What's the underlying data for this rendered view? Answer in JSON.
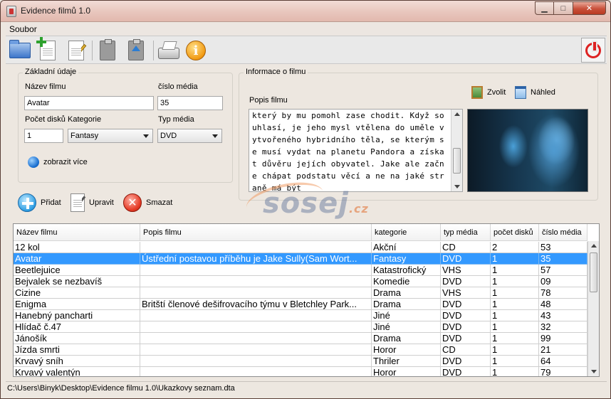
{
  "window": {
    "title": "Evidence filmů 1.0"
  },
  "menu": {
    "items": [
      "Soubor"
    ]
  },
  "basic_info": {
    "group_title": "Základní údaje",
    "name_label": "Název filmu",
    "name_value": "Avatar",
    "media_number_label": "číslo média",
    "media_number_value": "35",
    "disc_count_label": "Počet disků",
    "disc_count_value": "1",
    "category_label": "Kategorie",
    "category_value": "Fantasy",
    "media_type_label": "Typ média",
    "media_type_value": "DVD",
    "show_more_label": "zobrazit více"
  },
  "actions": {
    "add": "Přidat",
    "edit": "Upravit",
    "delete": "Smazat"
  },
  "film_info": {
    "group_title": "Informace o filmu",
    "description_label": "Popis filmu",
    "choose_label": "Zvolit",
    "preview_label": "Náhled",
    "description_lines": [
      "který by mu pomohl zase chodit. Když so",
      "uhlasí, je jeho mysl vtělena do uměle v",
      "ytvořeného hybridního těla, se kterým s",
      "e musí vydat na planetu Pandora a získa",
      "t důvěru jejích obyvatel. Jake ale začn",
      "e chápat podstatu věcí a ne na jaké str",
      "aně má být"
    ]
  },
  "watermark": {
    "text": "sosej",
    "suffix": ".cz"
  },
  "table": {
    "columns": [
      "Název filmu",
      "Popis filmu",
      "kategorie",
      "typ média",
      "počet disků",
      "číslo média"
    ],
    "rows": [
      [
        "12 kol",
        "",
        "Akční",
        "CD",
        "2",
        "53"
      ],
      [
        "Avatar",
        "Ústřední postavou příběhu je Jake Sully(Sam Wort...",
        "Fantasy",
        "DVD",
        "1",
        "35"
      ],
      [
        "Beetlejuice",
        "",
        "Katastrofický",
        "VHS",
        "1",
        "57"
      ],
      [
        "Bejvalek se nezbavíš",
        "",
        "Komedie",
        "DVD",
        "1",
        "09"
      ],
      [
        "Cizine",
        "",
        "Drama",
        "VHS",
        "1",
        "78"
      ],
      [
        "Enigma",
        "Britští členové dešifrovacího týmu v Bletchley Park...",
        "Drama",
        "DVD",
        "1",
        "48"
      ],
      [
        "Hanebný pancharti",
        "",
        "Jiné",
        "DVD",
        "1",
        "43"
      ],
      [
        "Hlídač č.47",
        "",
        "Jiné",
        "DVD",
        "1",
        "32"
      ],
      [
        "Jánošík",
        "",
        "Drama",
        "DVD",
        "1",
        "99"
      ],
      [
        "Jízda smrti",
        "",
        "Horor",
        "CD",
        "1",
        "21"
      ],
      [
        "Krvavý sníh",
        "",
        "Thriler",
        "DVD",
        "1",
        "64"
      ],
      [
        "Krvavý valentýn",
        "",
        "Horor",
        "DVD",
        "1",
        "79"
      ]
    ],
    "selected_row": 1
  },
  "status": {
    "path": "C:\\Users\\Binyk\\Desktop\\Evidence filmu 1.0\\Ukazkovy seznam.dta"
  },
  "colors": {
    "selection": "#3399ff",
    "close_button": "#c9503a"
  }
}
